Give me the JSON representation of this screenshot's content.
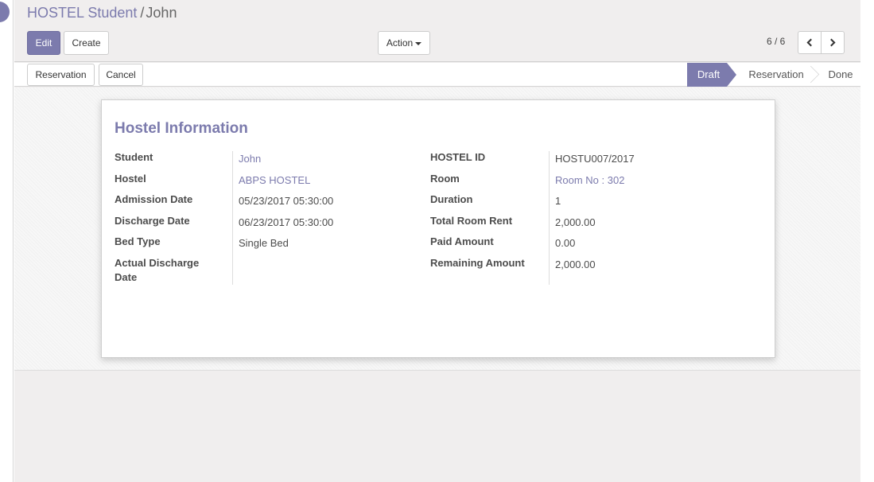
{
  "breadcrumb": {
    "parent": "HOSTEL Student",
    "separator": "/",
    "current": "John"
  },
  "toolbar": {
    "edit_label": "Edit",
    "create_label": "Create",
    "action_label": "Action"
  },
  "pager": {
    "value": "6 / 6"
  },
  "statusbar": {
    "buttons": [
      "Reservation",
      "Cancel"
    ],
    "stages": [
      "Draft",
      "Reservation",
      "Done"
    ],
    "active_stage": "Draft"
  },
  "colors": {
    "accent": "#7c7bad",
    "sheet_bg": "#ffffff",
    "panel_bg": "#f0eeee"
  },
  "form": {
    "title": "Hostel Information",
    "left": [
      {
        "label": "Student",
        "value": "John"
      },
      {
        "label": "Hostel",
        "value": "ABPS HOSTEL"
      },
      {
        "label": "Admission Date",
        "value": "05/23/2017 05:30:00"
      },
      {
        "label": "Discharge Date",
        "value": "06/23/2017 05:30:00"
      },
      {
        "label": "Bed Type",
        "value": "Single Bed"
      },
      {
        "label": "Actual Discharge Date",
        "value": ""
      }
    ],
    "right": [
      {
        "label": "HOSTEL ID",
        "value": "HOSTU007/2017"
      },
      {
        "label": "Room",
        "value": "Room No : 302"
      },
      {
        "label": "Duration",
        "value": "1"
      },
      {
        "label": "Total Room Rent",
        "value": "2,000.00"
      },
      {
        "label": "Paid Amount",
        "value": "0.00"
      },
      {
        "label": "Remaining Amount",
        "value": "2,000.00"
      }
    ]
  }
}
